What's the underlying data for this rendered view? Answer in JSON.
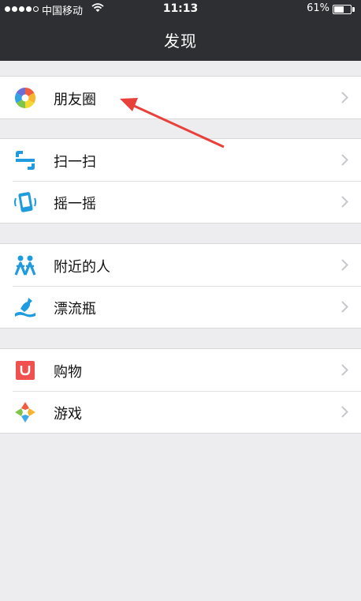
{
  "status_bar": {
    "carrier": "中国移动",
    "time": "11:13",
    "battery_percent": "61%",
    "battery_level": 0.61,
    "signal_bars_filled": 4,
    "signal_bars_total": 5
  },
  "header": {
    "title": "发现"
  },
  "groups": [
    {
      "items": [
        {
          "label": "朋友圈",
          "icon": "moments-icon"
        }
      ]
    },
    {
      "items": [
        {
          "label": "扫一扫",
          "icon": "scan-icon"
        },
        {
          "label": "摇一摇",
          "icon": "shake-icon"
        }
      ]
    },
    {
      "items": [
        {
          "label": "附近的人",
          "icon": "people-nearby-icon"
        },
        {
          "label": "漂流瓶",
          "icon": "drift-bottle-icon"
        }
      ]
    },
    {
      "items": [
        {
          "label": "购物",
          "icon": "shopping-icon"
        },
        {
          "label": "游戏",
          "icon": "games-icon"
        }
      ]
    }
  ],
  "annotation": {
    "color": "#e8413b"
  },
  "colors": {
    "nav_background": "#2e2f33",
    "page_background": "#ededf0",
    "chevron": "#c7c7cc"
  }
}
